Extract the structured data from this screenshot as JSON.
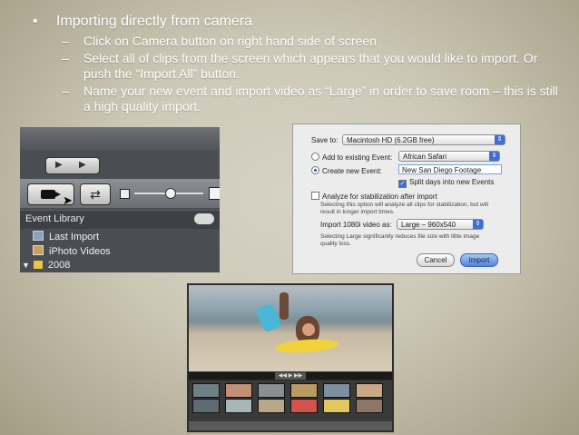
{
  "slide": {
    "bullet_main": "Importing directly from camera",
    "sub_bullets": [
      "Click on Camera button on right hand side of screen",
      "Select all of clips from the screen which appears that you would like to import. Or push the “Import All” button.",
      "Name your new event and import video as “Large” in order to save room – this is still a high quality import."
    ]
  },
  "library_panel": {
    "header": "Event Library",
    "items": [
      {
        "label": "Last Import",
        "icon": "film-icon"
      },
      {
        "label": "iPhoto Videos",
        "icon": "photo-icon"
      },
      {
        "label": "2008",
        "icon": "folder-icon"
      }
    ]
  },
  "import_dialog": {
    "save_to_label": "Save to:",
    "save_to_value": "Macintosh HD (6.2GB free)",
    "add_existing_label": "Add to existing Event:",
    "add_existing_value": "African Safari",
    "create_new_label": "Create new Event:",
    "create_new_value": "New San Diego Footage",
    "split_days_label": "Split days into new Events",
    "analyze_label": "Analyze for stabilization after import",
    "analyze_note": "Selecting this option will analyze all clips for stabilization, but will result in longer import times.",
    "import_as_label": "Import 1080i video as:",
    "import_as_value": "Large – 960x540",
    "large_note": "Selecting Large significantly reduces file size with little image quality loss.",
    "cancel_label": "Cancel",
    "import_label": "Import"
  },
  "colors": {
    "accent": "#3f6ed7",
    "slide_bg": "#cdc8b6"
  }
}
